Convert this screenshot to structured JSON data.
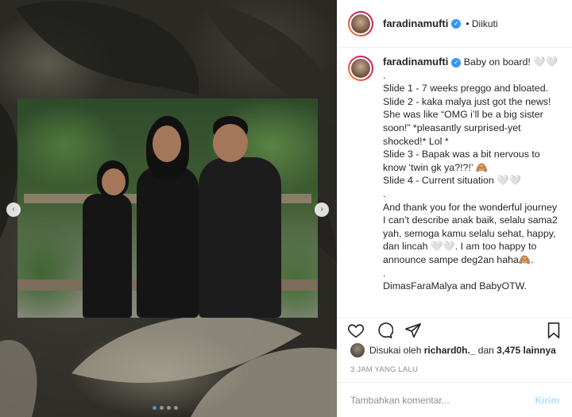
{
  "post": {
    "username": "faradinamufti",
    "follow_status": "• Diikuti",
    "caption_lines": [
      "Baby on board! 🤍🤍",
      ".",
      "Slide 1 - 7 weeks preggo and bloated.",
      "Slide 2 - kaka malya just got the news! She was like “OMG i’ll be a big sister soon!” *pleasantly surprised-yet shocked!* Lol *",
      "Slide 3 - Bapak was a bit nervous to know ‘twin gk ya?!?!’ 🙈",
      "Slide 4 - Current situation 🤍🤍",
      ".",
      "And thank you for the wonderful journey I can’t describe anak baik, selalu sama2 yah, semoga kamu selalu sehat, happy, dan lincah 🤍🤍. I am too happy to announce sampe deg2an haha🙈.",
      ".",
      "DimasFaraMalya and BabyOTW."
    ],
    "liked_by_prefix": "Disukai oleh",
    "liked_by_user": "richard0h._",
    "liked_by_suffix": "dan",
    "likes_count": "3,475 lainnya",
    "timestamp": "3 JAM YANG LALU",
    "comment_placeholder": "Tambahkan komentar...",
    "comment_button": "Kirim"
  },
  "carousel": {
    "prev_symbol": "‹",
    "next_symbol": "›",
    "slide_count": 4,
    "active_slide": 1
  },
  "icons": {
    "like": "heart-icon",
    "comment": "comment-icon",
    "share": "share-icon",
    "save": "bookmark-icon",
    "verified": "verified-badge-icon"
  },
  "colors": {
    "accent": "#3897f0",
    "text": "#262626",
    "muted": "#8e8e8e",
    "border": "#efefef"
  }
}
